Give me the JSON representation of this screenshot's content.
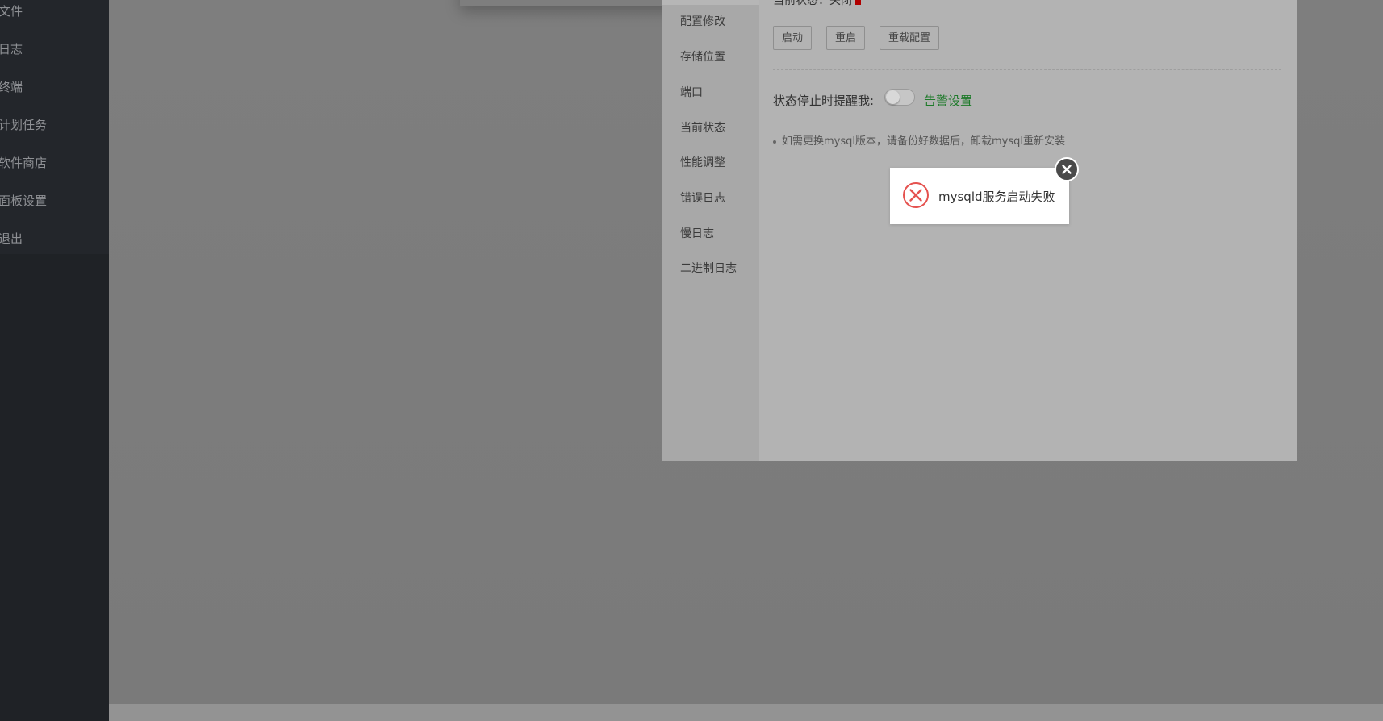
{
  "sidebar": {
    "items": [
      {
        "label": "文件"
      },
      {
        "label": "日志"
      },
      {
        "label": "终端"
      },
      {
        "label": "计划任务"
      },
      {
        "label": "软件商店"
      },
      {
        "label": "面板设置"
      },
      {
        "label": "退出"
      }
    ]
  },
  "plugin_window": {
    "menu": [
      {
        "label": "配置修改"
      },
      {
        "label": "存储位置"
      },
      {
        "label": "端口"
      },
      {
        "label": "当前状态"
      },
      {
        "label": "性能调整"
      },
      {
        "label": "错误日志"
      },
      {
        "label": "慢日志"
      },
      {
        "label": "二进制日志"
      }
    ],
    "status_text": "当前状态：关闭",
    "buttons": {
      "start": "启动",
      "restart": "重启",
      "reload": "重载配置"
    },
    "notify_label": "状态停止时提醒我:",
    "notify_toggle_on": false,
    "alarm_link": "告警设置",
    "tip": "如需更换mysql版本，请备份好数据后，卸载mysql重新安装"
  },
  "toast": {
    "message": "mysqld服务启动失败",
    "icon": "error-circle-x-icon",
    "close_icon": "close-icon"
  },
  "colors": {
    "sidebar_bg": "#1f2226",
    "overlay_gray": "#7a7a7a",
    "link_green": "#1e7a2a",
    "error_red": "#e5524f",
    "status_red": "#b00000"
  }
}
